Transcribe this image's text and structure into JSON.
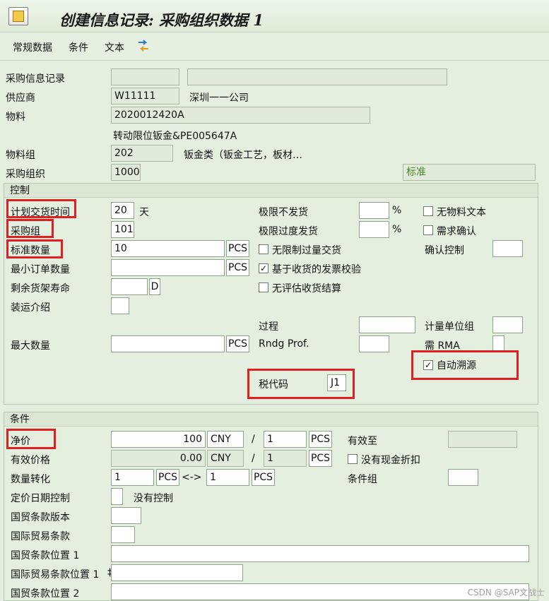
{
  "window": {
    "title": "创建信息记录: 采购组织数据 1"
  },
  "toolbar": {
    "general_data": "常规数据",
    "conditions": "条件",
    "text": "文本"
  },
  "header": {
    "info_record_label": "采购信息记录",
    "vendor_label": "供应商",
    "vendor_value": "W11111",
    "vendor_name": "深圳一一公司",
    "material_label": "物料",
    "material_value": "2020012420A",
    "material_desc": "转动限位钣金&PE005647A",
    "material_group_label": "物料组",
    "material_group_value": "202",
    "material_group_desc": "钣金类（钣金工艺，板材…",
    "purch_org_label": "采购组织",
    "purch_org_value": "1000",
    "standard": "标准"
  },
  "control": {
    "title": "控制",
    "planned_delivery_label": "计划交货时间",
    "planned_delivery_value": "20",
    "days": "天",
    "purch_group_label": "采购组",
    "purch_group_value": "101",
    "std_qty_label": "标准数量",
    "std_qty_value": "10",
    "std_qty_unit": "PCS",
    "min_order_label": "最小订单数量",
    "min_order_unit": "PCS",
    "shelf_life_label": "剩余货架寿命",
    "shelf_life_unit": "D",
    "shipping_instr_label": "装运介绍",
    "max_qty_label": "最大数量",
    "max_qty_unit": "PCS",
    "underdelivery_label": "极限不发货",
    "overdelivery_label": "极限过度发货",
    "percent": "%",
    "unlimited_label": "无限制过量交货",
    "gr_iv_label": "基于收货的发票校验",
    "ers_label": "无评估收货结算",
    "procedure_label": "过程",
    "rounding_label": "Rndg Prof.",
    "no_mat_text_label": "无物料文本",
    "ack_req_label": "需求确认",
    "conf_ctrl_label": "确认控制",
    "uom_group_label": "计量单位组",
    "rma_label": "需 RMA",
    "auto_sourcing_label": "自动溯源",
    "tax_code_label": "税代码",
    "tax_code_value": "J1"
  },
  "conditions": {
    "title": "条件",
    "net_price_label": "净价",
    "net_price_value": "100",
    "currency": "CNY",
    "per": "/",
    "per_value": "1",
    "per_unit": "PCS",
    "valid_to_label": "有效至",
    "eff_price_label": "有效价格",
    "eff_price_value": "0.00",
    "eff_currency": "CNY",
    "eff_per_value": "1",
    "eff_per_unit": "PCS",
    "no_cash_discount_label": "没有现金折扣",
    "qty_conv_label": "数量转化",
    "qty_conv_from": "1",
    "qty_conv_from_unit": "PCS",
    "arrow": "<->",
    "qty_conv_to": "1",
    "qty_conv_to_unit": "PCS",
    "cond_group_label": "条件组",
    "pricing_date_label": "定价日期控制",
    "pricing_date_text": "没有控制",
    "incoterms_version_label": "国贸条款版本",
    "incoterms_label": "国际贸易条款",
    "incoterms_loc1_label": "国贸条款位置 1",
    "intl_incoterms_loc1_label": "国际贸易条款位置 1",
    "incoterms_loc2_label": "国贸条款位置 2",
    "loc_overflow": "‡"
  },
  "watermark": "CSDN @SAP文战士"
}
